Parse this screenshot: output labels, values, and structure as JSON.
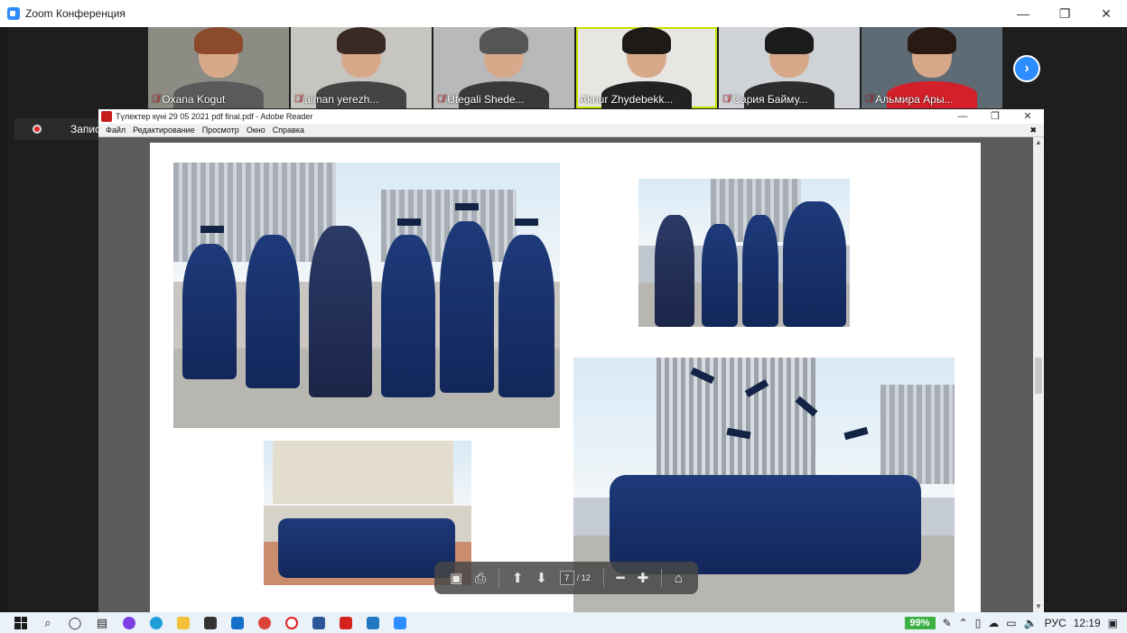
{
  "zoom": {
    "title": "Zoom Конференция",
    "controls": {
      "minimize": "—",
      "restore": "❐",
      "close": "✕"
    },
    "participants": [
      {
        "name": "Oxana Kogut",
        "muted": true,
        "hair": "#8b4a2b",
        "clothes": "#5a5a5a",
        "bg": "#8c8c85"
      },
      {
        "name": "aiman yerezh...",
        "muted": true,
        "hair": "#3b2a24",
        "clothes": "#444",
        "bg": "#c7c5c0"
      },
      {
        "name": "Utegali Shede...",
        "muted": true,
        "hair": "#555555",
        "clothes": "#3a3a3a",
        "bg": "#b9b9b9"
      },
      {
        "name": "Aknur Zhydebekk...",
        "muted": false,
        "hair": "#1e1a18",
        "clothes": "#222",
        "bg": "#e8e6e2"
      },
      {
        "name": "Сария Байму...",
        "muted": true,
        "hair": "#1b1b1b",
        "clothes": "#2c2c2c",
        "bg": "#cfd2d6"
      },
      {
        "name": "Альмира Ары...",
        "muted": true,
        "hair": "#2a1a14",
        "clothes": "#d4202a",
        "bg": "#5f6b74"
      }
    ],
    "next_label": "›",
    "recording_label": "Запись"
  },
  "reader": {
    "title": "Түлектер күні 29 05 2021 pdf final.pdf - Adobe Reader",
    "controls": {
      "minimize": "—",
      "restore": "❐",
      "close": "✕"
    },
    "menu": [
      "Файл",
      "Редактирование",
      "Просмотр",
      "Окно",
      "Справка"
    ],
    "menu_close": "✖",
    "page_current": "7",
    "page_total": "/ 12"
  },
  "taskbar": {
    "battery": "99%",
    "language": "РУС",
    "time": "12:19"
  }
}
